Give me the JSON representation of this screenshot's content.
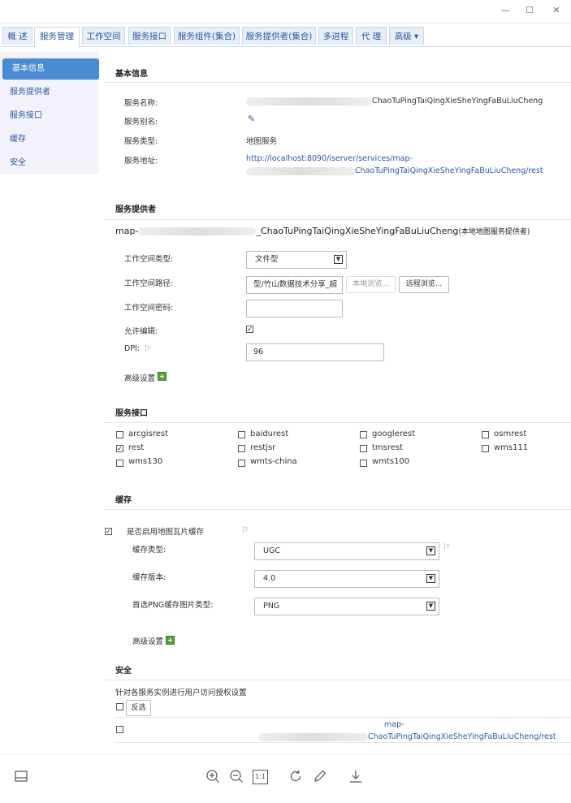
{
  "tabs": [
    {
      "label": "概 述"
    },
    {
      "label": "服务管理"
    },
    {
      "label": "工作空间"
    },
    {
      "label": "服务接口"
    },
    {
      "label": "服务组件(集合)"
    },
    {
      "label": "服务提供者(集合)"
    },
    {
      "label": "多进程"
    },
    {
      "label": "代 理"
    },
    {
      "label": "高级 ▾"
    }
  ],
  "sidebar": {
    "items": [
      {
        "label": "基本信息"
      },
      {
        "label": "服务提供者"
      },
      {
        "label": "服务接口"
      },
      {
        "label": "缓存"
      },
      {
        "label": "安全"
      }
    ]
  },
  "basic": {
    "title": "基本信息",
    "name_label": "服务名称:",
    "name_value": "ChaoTuPingTaiQingXieSheYingFaBuLiuCheng",
    "alias_label": "服务别名:",
    "type_label": "服务类型:",
    "type_value": "地图服务",
    "addr_label": "服务地址:",
    "addr_line1": "http://localhost:8090/iserver/services/map-",
    "addr_line2": "ChaoTuPingTaiQingXieSheYingFaBuLiuCheng/rest"
  },
  "provider": {
    "title": "服务提供者",
    "name_prefix": "map-",
    "name_suffix": "_ChaoTuPingTaiQingXieSheYingFaBuLiuCheng",
    "name_note": "(本地地图服务提供者)",
    "ws_type_label": "工作空间类型:",
    "ws_type_value": "文件型",
    "ws_path_label": "工作空间路径:",
    "ws_path_value": "型/竹山数据技术分享_超",
    "local_browse": "本地浏览...",
    "remote_browse": "远程浏览...",
    "ws_pwd_label": "工作空间密码:",
    "allow_edit_label": "允许编辑:",
    "dpi_label": "DPI:",
    "dpi_value": "96",
    "advanced_label": "高级设置"
  },
  "interfaces": {
    "title": "服务接口",
    "items": [
      {
        "label": "arcgisrest",
        "checked": false
      },
      {
        "label": "baidurest",
        "checked": false
      },
      {
        "label": "googlerest",
        "checked": false
      },
      {
        "label": "osmrest",
        "checked": false
      },
      {
        "label": "rest",
        "checked": true
      },
      {
        "label": "restjsr",
        "checked": false
      },
      {
        "label": "tmsrest",
        "checked": false
      },
      {
        "label": "wms111",
        "checked": false
      },
      {
        "label": "wms130",
        "checked": false
      },
      {
        "label": "wmts-china",
        "checked": false
      },
      {
        "label": "wmts100",
        "checked": false
      }
    ]
  },
  "cache": {
    "title": "缓存",
    "enable_label": "是否启用地图瓦片缓存",
    "type_label": "缓存类型:",
    "type_value": "UGC",
    "version_label": "缓存版本:",
    "version_value": "4.0",
    "png_label": "首选PNG缓存图片类型:",
    "png_value": "PNG",
    "advanced_label": "高级设置"
  },
  "security": {
    "title": "安全",
    "desc": "针对各服务实例进行用户访问授权设置",
    "invert_label": "反选",
    "row_line1": "map-",
    "row_line2": "ChaoTuPingTaiQingXieSheYingFaBuLiuCheng/rest"
  },
  "icons": {
    "minimize": "minimize-icon",
    "maximize": "maximize-icon",
    "close": "close-icon",
    "edit": "edit-icon",
    "zoom_in": "zoom-in-icon",
    "zoom_out": "zoom-out-icon",
    "actual_size": "1:1",
    "rotate": "rotate-icon",
    "pen": "pen-icon",
    "download": "download-icon"
  }
}
